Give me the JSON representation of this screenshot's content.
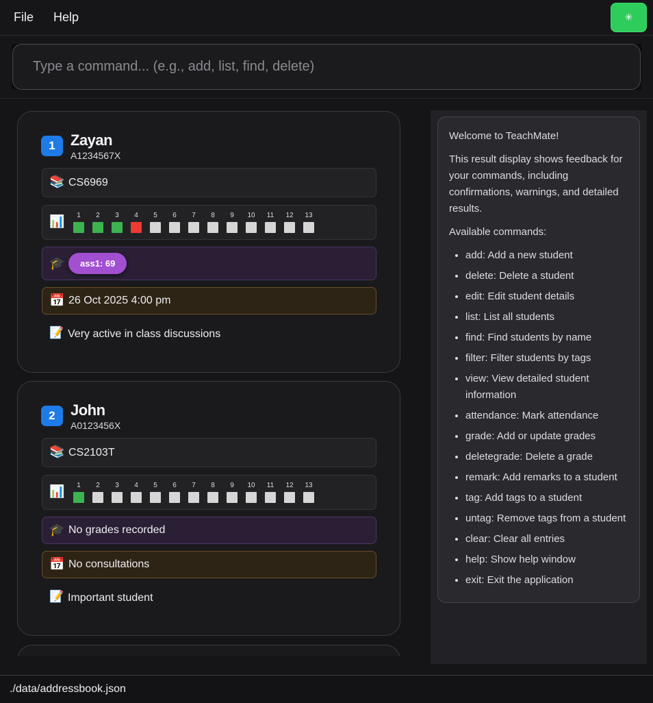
{
  "menu": {
    "file": "File",
    "help": "Help",
    "theme_icon": "✳"
  },
  "command": {
    "placeholder": "Type a command... (e.g., add, list, find, delete)",
    "value": ""
  },
  "colors": {
    "present": "#3db34f",
    "absent": "#ee3b31",
    "unmarked": "#d6d6d6",
    "accent": "#1e7be8",
    "grade_pill": "#a34fd1"
  },
  "students": [
    {
      "index": "1",
      "name": "Zayan",
      "id": "A1234567X",
      "course_icon": "📚",
      "course": "CS6969",
      "attendance_icon": "📊",
      "weeks": [
        {
          "n": "1",
          "s": "present"
        },
        {
          "n": "2",
          "s": "present"
        },
        {
          "n": "3",
          "s": "present"
        },
        {
          "n": "4",
          "s": "absent"
        },
        {
          "n": "5",
          "s": "unmarked"
        },
        {
          "n": "6",
          "s": "unmarked"
        },
        {
          "n": "7",
          "s": "unmarked"
        },
        {
          "n": "8",
          "s": "unmarked"
        },
        {
          "n": "9",
          "s": "unmarked"
        },
        {
          "n": "10",
          "s": "unmarked"
        },
        {
          "n": "11",
          "s": "unmarked"
        },
        {
          "n": "12",
          "s": "unmarked"
        },
        {
          "n": "13",
          "s": "unmarked"
        }
      ],
      "grade_icon": "🎓",
      "grade": "ass1: 69",
      "consult_icon": "📅",
      "consultation": "26 Oct 2025 4:00 pm",
      "remark_icon": "📝",
      "remark": "Very active in class discussions"
    },
    {
      "index": "2",
      "name": "John",
      "id": "A0123456X",
      "course_icon": "📚",
      "course": "CS2103T",
      "attendance_icon": "📊",
      "weeks": [
        {
          "n": "1",
          "s": "present"
        },
        {
          "n": "2",
          "s": "unmarked"
        },
        {
          "n": "3",
          "s": "unmarked"
        },
        {
          "n": "4",
          "s": "unmarked"
        },
        {
          "n": "5",
          "s": "unmarked"
        },
        {
          "n": "6",
          "s": "unmarked"
        },
        {
          "n": "7",
          "s": "unmarked"
        },
        {
          "n": "8",
          "s": "unmarked"
        },
        {
          "n": "9",
          "s": "unmarked"
        },
        {
          "n": "10",
          "s": "unmarked"
        },
        {
          "n": "11",
          "s": "unmarked"
        },
        {
          "n": "12",
          "s": "unmarked"
        },
        {
          "n": "13",
          "s": "unmarked"
        }
      ],
      "grade_icon": "🎓",
      "grade_empty": "No grades recorded",
      "consult_icon": "📅",
      "consultation": "No consultations",
      "remark_icon": "📝",
      "remark": "Important student"
    }
  ],
  "result": {
    "welcome": "Welcome to TeachMate!",
    "intro": "This result display shows feedback for your commands, including confirmations, warnings, and detailed results.",
    "commands_heading": "Available commands:",
    "commands": [
      "add: Add a new student",
      "delete: Delete a student",
      "edit: Edit student details",
      "list: List all students",
      "find: Find students by name",
      "filter: Filter students by tags",
      "view: View detailed student information",
      "attendance: Mark attendance",
      "grade: Add or update grades",
      "deletegrade: Delete a grade",
      "remark: Add remarks to a student",
      "tag: Add tags to a student",
      "untag: Remove tags from a student",
      "clear: Clear all entries",
      "help: Show help window",
      "exit: Exit the application"
    ]
  },
  "status": {
    "path": "./data/addressbook.json"
  }
}
